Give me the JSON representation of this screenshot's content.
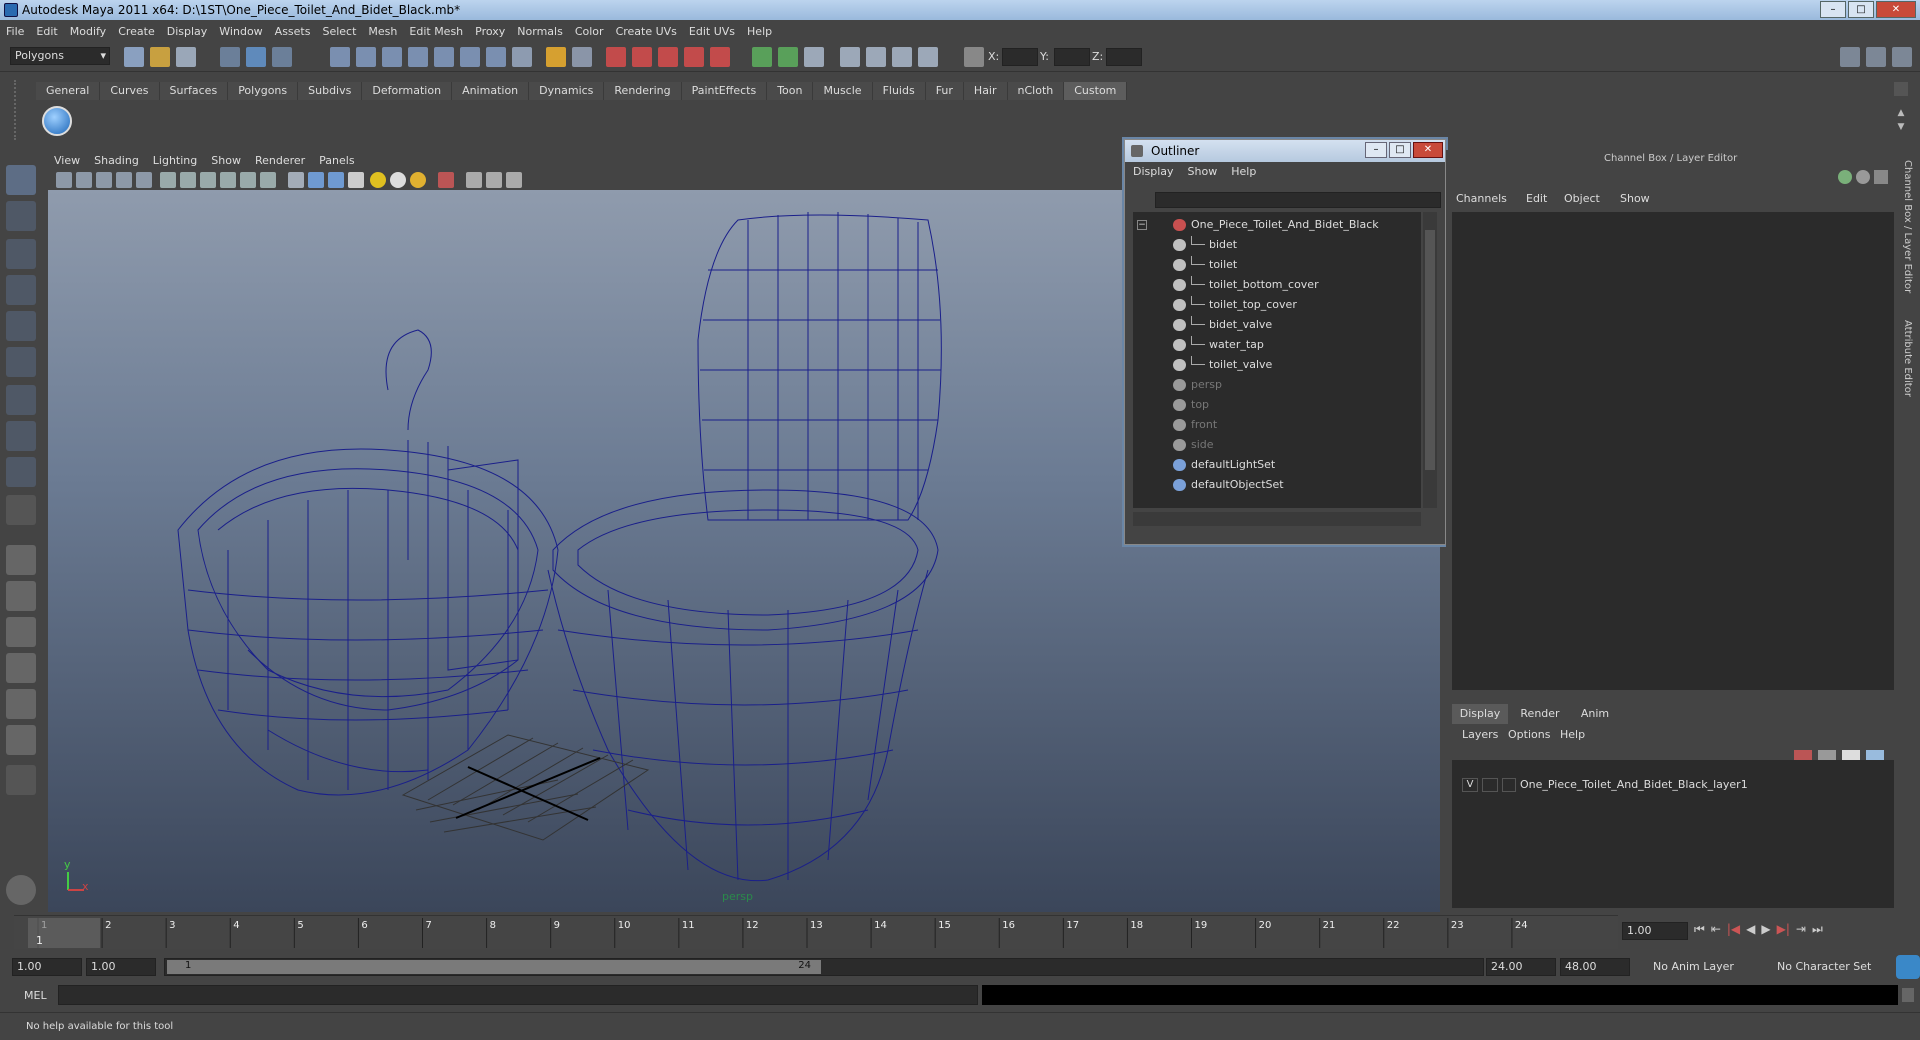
{
  "window": {
    "title": "Autodesk Maya 2011 x64: D:\\1ST\\One_Piece_Toilet_And_Bidet_Black.mb*"
  },
  "menubar": [
    "File",
    "Edit",
    "Modify",
    "Create",
    "Display",
    "Window",
    "Assets",
    "Select",
    "Mesh",
    "Edit Mesh",
    "Proxy",
    "Normals",
    "Color",
    "Create UVs",
    "Edit UVs",
    "Help"
  ],
  "statusline": {
    "mode": "Polygons",
    "x_label": "X:",
    "y_label": "Y:",
    "z_label": "Z:"
  },
  "shelf": {
    "tabs": [
      "General",
      "Curves",
      "Surfaces",
      "Polygons",
      "Subdivs",
      "Deformation",
      "Animation",
      "Dynamics",
      "Rendering",
      "PaintEffects",
      "Toon",
      "Muscle",
      "Fluids",
      "Fur",
      "Hair",
      "nCloth",
      "Custom"
    ],
    "active_tab": "Custom"
  },
  "viewport": {
    "menu": [
      "View",
      "Shading",
      "Lighting",
      "Show",
      "Renderer",
      "Panels"
    ],
    "camera_label": "persp",
    "axis_y": "y",
    "axis_x": "x"
  },
  "outliner": {
    "title": "Outliner",
    "menu": [
      "Display",
      "Show",
      "Help"
    ],
    "items": [
      {
        "label": "One_Piece_Toilet_And_Bidet_Black",
        "depth": 0,
        "dim": false,
        "icon": "group-icon"
      },
      {
        "label": "bidet",
        "depth": 1,
        "dim": false,
        "icon": "mesh-icon"
      },
      {
        "label": "toilet",
        "depth": 1,
        "dim": false,
        "icon": "mesh-icon"
      },
      {
        "label": "toilet_bottom_cover",
        "depth": 1,
        "dim": false,
        "icon": "mesh-icon"
      },
      {
        "label": "toilet_top_cover",
        "depth": 1,
        "dim": false,
        "icon": "mesh-icon"
      },
      {
        "label": "bidet_valve",
        "depth": 1,
        "dim": false,
        "icon": "mesh-icon"
      },
      {
        "label": "water_tap",
        "depth": 1,
        "dim": false,
        "icon": "mesh-icon"
      },
      {
        "label": "toilet_valve",
        "depth": 1,
        "dim": false,
        "icon": "mesh-icon"
      },
      {
        "label": "persp",
        "depth": 0,
        "dim": true,
        "icon": "camera-icon"
      },
      {
        "label": "top",
        "depth": 0,
        "dim": true,
        "icon": "camera-icon"
      },
      {
        "label": "front",
        "depth": 0,
        "dim": true,
        "icon": "camera-icon"
      },
      {
        "label": "side",
        "depth": 0,
        "dim": true,
        "icon": "camera-icon"
      },
      {
        "label": "defaultLightSet",
        "depth": 0,
        "dim": false,
        "icon": "set-icon"
      },
      {
        "label": "defaultObjectSet",
        "depth": 0,
        "dim": false,
        "icon": "set-icon"
      }
    ]
  },
  "channelbox": {
    "header": "Channel Box / Layer Editor",
    "menu": [
      "Channels",
      "Edit",
      "Object",
      "Show"
    ],
    "side_tabs": [
      "Channel Box / Layer Editor",
      "Attribute Editor"
    ]
  },
  "layers": {
    "tabs": [
      "Display",
      "Render",
      "Anim"
    ],
    "active_tab": "Display",
    "menu": [
      "Layers",
      "Options",
      "Help"
    ],
    "rows": [
      {
        "visible": "V",
        "name": "One_Piece_Toilet_And_Bidet_Black_layer1"
      }
    ]
  },
  "timeline": {
    "ticks": [
      "1",
      "2",
      "3",
      "4",
      "5",
      "6",
      "7",
      "8",
      "9",
      "10",
      "11",
      "12",
      "13",
      "14",
      "15",
      "16",
      "17",
      "18",
      "19",
      "20",
      "21",
      "22",
      "23",
      "24"
    ],
    "current_frame_marker": "1",
    "current_frame_field": "1.00"
  },
  "range": {
    "start": "1.00",
    "playback_start": "1.00",
    "slider_start": "1",
    "slider_end": "24",
    "playback_end": "24.00",
    "end": "48.00",
    "anim_layer": "No Anim Layer",
    "character_set": "No Character Set"
  },
  "cmdline": {
    "label": "MEL"
  },
  "helpline": {
    "text": "No help available for this tool"
  }
}
